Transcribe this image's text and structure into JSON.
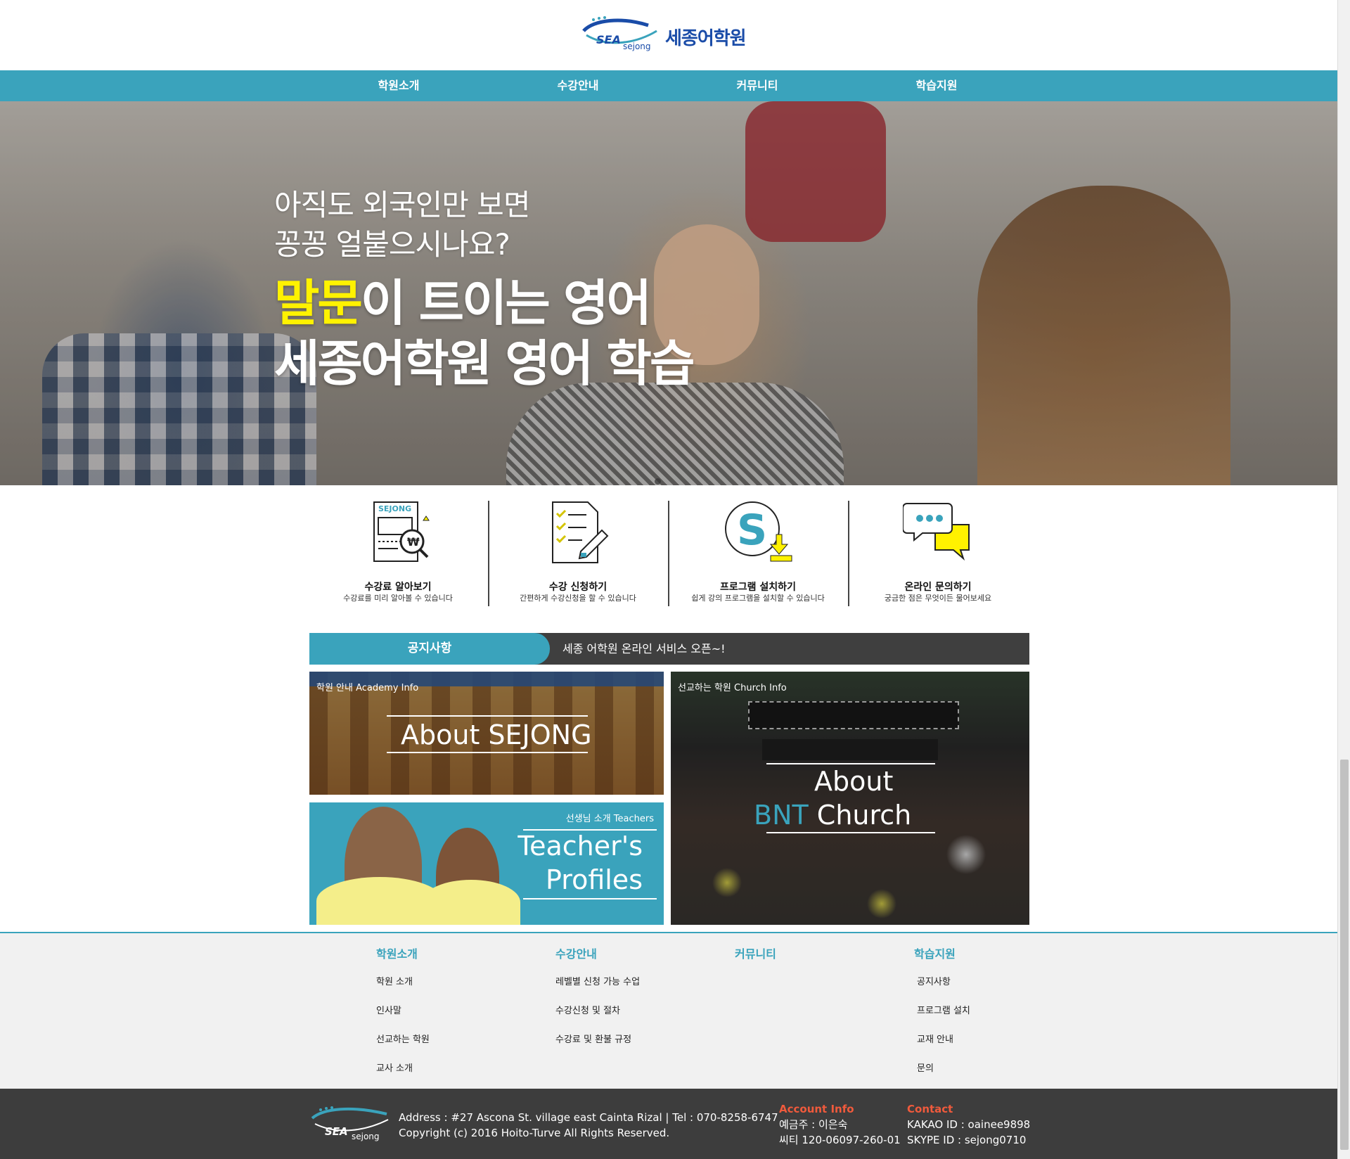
{
  "header": {
    "logo_mark": "SEA",
    "logo_sub": "sejong",
    "logo_text": "세종어학원"
  },
  "nav": [
    "학원소개",
    "수강안내",
    "커뮤니티",
    "학습지원"
  ],
  "hero": {
    "line1": "아직도 외국인만 보면",
    "line2": "꽁꽁 얼붙으시나요?",
    "highlight": "말문",
    "line3_rest": "이 트이는 영어",
    "line4": "세종어학원 영어 학습"
  },
  "quick_links": [
    {
      "title": "수강료 알아보기",
      "desc": "수강료를 미리 알아볼 수 있습니다",
      "icon": "receipt-icon",
      "badge": "SEJONG"
    },
    {
      "title": "수강 신청하기",
      "desc": "간편하게 수강신청을 할 수 있습니다",
      "icon": "checklist-icon"
    },
    {
      "title": "프로그램 설치하기",
      "desc": "쉽게 강의 프로그램을 설치할 수 있습니다",
      "icon": "skype-download-icon"
    },
    {
      "title": "온라인 문의하기",
      "desc": "궁금한 점은 무엇이든 물어보세요",
      "icon": "chat-bubbles-icon"
    }
  ],
  "notice": {
    "label": "공지사항",
    "text": "세종 어학원 온라인 서비스 오픈~!"
  },
  "panels": {
    "academy": {
      "tag": "학원 안내 Academy Info",
      "title": "About SEJONG"
    },
    "teacher": {
      "tag": "선생님 소개 Teachers",
      "title_line1": "Teacher's",
      "title_line2": "Profiles"
    },
    "church": {
      "tag": "선교하는 학원 Church Info",
      "title_line1": "About",
      "title_bnt": "BNT",
      "title_church": " Church"
    }
  },
  "footer_nav": [
    {
      "head": "학원소개",
      "links": [
        "학원 소개",
        "인사말",
        "선교하는 학원",
        "교사 소개"
      ]
    },
    {
      "head": "수강안내",
      "links": [
        "레벨별 신청 가능 수업",
        "수강신청 및 절차",
        "수강료 및 환불 규정"
      ]
    },
    {
      "head": "커뮤니티",
      "links": []
    },
    {
      "head": "학습지원",
      "links": [
        "공지사항",
        "프로그램 설치",
        "교재 안내",
        "문의"
      ]
    }
  ],
  "footer": {
    "address": "Address : #27 Ascona St. village east Cainta Rizal | Tel : 070-8258-6747",
    "copyright": "Copyright (c) 2016 Hoito-Turve All Rights Reserved.",
    "account_head": "Account Info",
    "account_line1": "예금주 : 이은숙",
    "account_line2": "씨티 120-06097-260-01",
    "contact_head": "Contact",
    "contact_line1": "KAKAO ID : oainee9898",
    "contact_line2": "SKYPE ID : sejong0710"
  },
  "colors": {
    "accent": "#3aa3bc",
    "highlight": "#fff200",
    "footer_red": "#f05a3c",
    "dark": "#3d3d3d"
  }
}
